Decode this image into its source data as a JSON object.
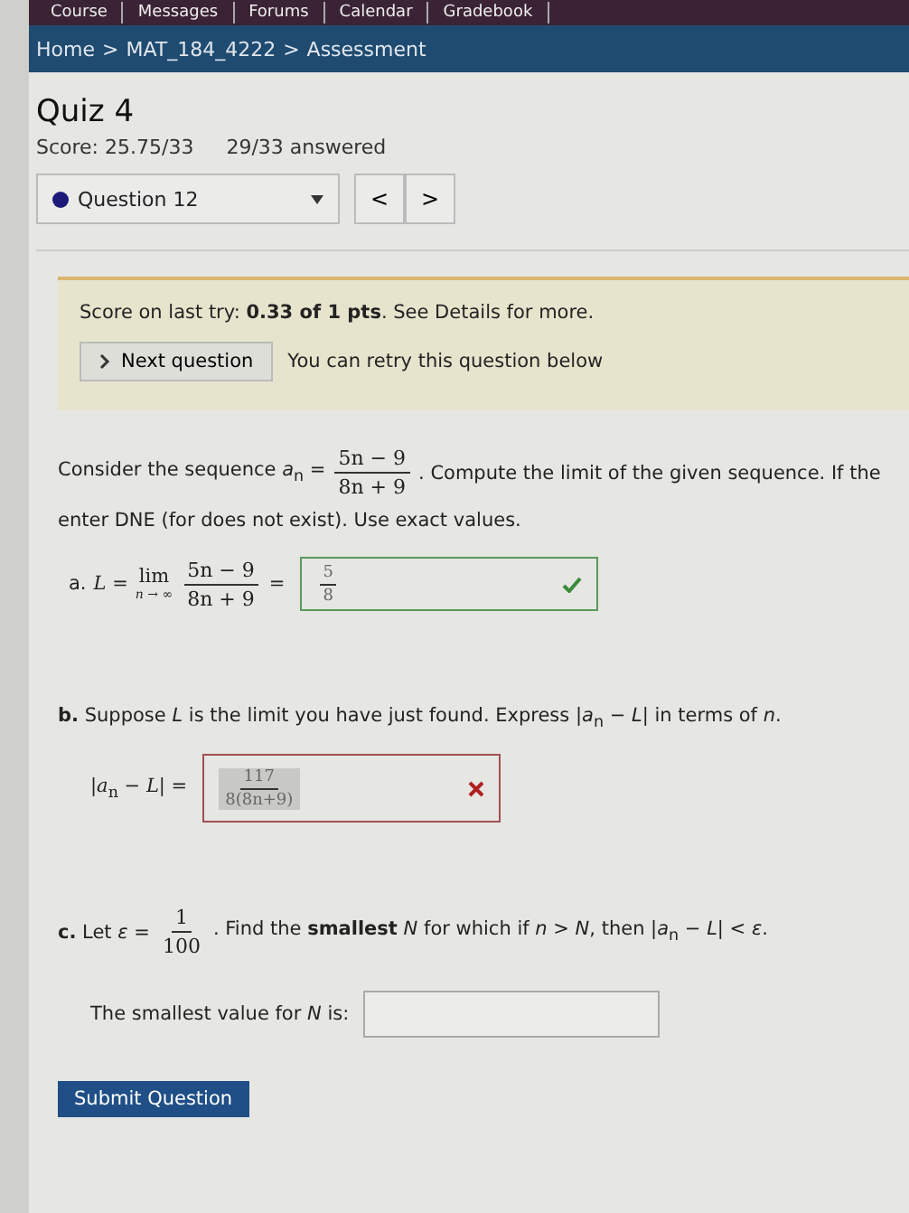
{
  "nav_tabs": [
    "Course",
    "Messages",
    "Forums",
    "Calendar",
    "Gradebook"
  ],
  "breadcrumb": {
    "items": [
      "Home",
      "MAT_184_4222",
      "Assessment"
    ],
    "separator": ">"
  },
  "title": "Quiz 4",
  "score": "Score: 25.75/33",
  "answered": "29/33 answered",
  "question_select": {
    "label": "Question 12",
    "color": "#1c1a78"
  },
  "pager": [
    "<",
    ">"
  ],
  "feedback": {
    "text": "Score on last try: **0.33 of 1 pts**. See Details for more.",
    "next_button": "Next question",
    "retry_note": "You can retry this question below"
  },
  "intro": [
    {
      "segments": [
        {
          "text": "Consider the sequence *a*$_{n}$ ="
        },
        {
          "num": "5n − 9",
          "den": "8n + 9"
        },
        {
          "text": ". Compute the limit of the given sequence. If the"
        }
      ]
    },
    {
      "segments": [
        {
          "text": "enter DNE (for does not exist). Use exact values."
        }
      ]
    }
  ],
  "parts": [
    {
      "kind": "limit",
      "label": "a.",
      "lhs": "*L* =",
      "lim": "lim",
      "lim_under": "*n* → ∞",
      "num": "5n − 9",
      "den": "8n + 9",
      "equals": "=",
      "answer": {
        "num": "5",
        "den": "8"
      },
      "correct": true
    },
    {
      "kind": "expression",
      "prompt": [
        {
          "text": "**b.** Suppose *L* is the limit you have just found. Express |*a*$_{n}$ − *L*| in terms of *n*."
        }
      ],
      "lhs": "|*a*$_{n}$ − *L*| =",
      "answer": {
        "num": "117",
        "den": "8(8n+9)"
      },
      "correct": false
    },
    {
      "kind": "number",
      "prompt": [
        {
          "text": "**c.** Let *ε* ="
        },
        {
          "num": "1",
          "den": "100"
        },
        {
          "text": ". Find the **smallest** *N* for which if *n* > *N*, then |*a*$_{n}$ − *L*| < *ε*."
        }
      ],
      "answer_label": "The smallest value for *N* is:"
    }
  ],
  "submit_button": "Submit Question"
}
